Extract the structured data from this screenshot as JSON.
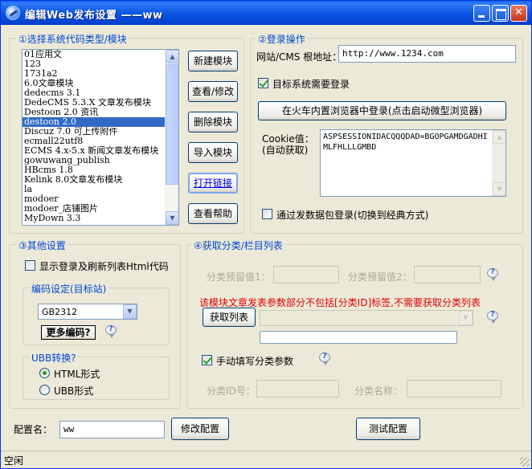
{
  "window": {
    "title": "编辑Web发布设置 ——ww"
  },
  "module": {
    "legend": "①选择系统代码类型/模块",
    "items": [
      "01应用文",
      "123",
      "1731a2",
      "6.0文章模块",
      "dedecms 3.1",
      "DedeCMS 5.3.X 文章发布模块",
      "Destoon 2.0 资讯",
      "destoon 2.0",
      "Discuz 7.0 可上传附件",
      "ecmall22utf8",
      "ECMS 4.x-5.x 新闻文章发布模块",
      "gowuwang_publish",
      "HBcms 1.8",
      "Kelink 8.0文章发布模块",
      "la",
      "modoer",
      "modoer_店铺图片",
      "MyDown 3.3"
    ],
    "selected": "destoon 2.0",
    "buttons": {
      "new": "新建模块",
      "edit": "查看/修改",
      "delete": "删除模块",
      "import": "导入模块",
      "open_link": "打开链接",
      "help": "查看帮助"
    }
  },
  "login": {
    "legend": "②登录操作",
    "url_label": "网站/CMS 根地址：",
    "url_value": "http://www.1234.com",
    "need_login_label": "目标系统需要登录",
    "need_login_checked": true,
    "browser_login_button": "在火车内置浏览器中登录(点击启动微型浏览器)",
    "cookie_label": "Cookie值：",
    "cookie_sub_label": "(自动获取)",
    "cookie_value": "ASPSESSIONIDACQQQDAD=BGOPGAMDGADHIMLFHLLLGMBD",
    "packet_login_label": "通过发数据包登录(切换到经典方式)",
    "packet_login_checked": false
  },
  "other": {
    "legend": "③其他设置",
    "show_html_label": "显示登录及刷新列表Html代码",
    "show_html_checked": false,
    "encoding_legend": "编码设定(目标站)",
    "encoding_value": "GB2312",
    "more_encoding_button": "更多编码?",
    "ubb_legend": "UBB转换?",
    "html_option": "HTML形式",
    "ubb_option": "UBB形式",
    "selected_option": "HTML形式"
  },
  "category": {
    "legend": "④获取分类/栏目列表",
    "reserved1_label": "分类预留值1：",
    "reserved2_label": "分类预留值2：",
    "warning": "该模块文章发表参数部分不包括[分类ID]标签,不需要获取分类列表",
    "get_list_button": "获取列表",
    "manual_label": "手动填写分类参数",
    "manual_checked": true,
    "cat_id_label": "分类ID号：",
    "cat_name_label": "分类名称："
  },
  "footer": {
    "config_name_label": "配置名：",
    "config_name_value": "ww",
    "modify_button": "修改配置",
    "test_button": "测试配置"
  },
  "status": {
    "text": "空闲"
  },
  "colors": {
    "accent": "#0046d5",
    "warning": "#e00000",
    "selection": "#316ac5",
    "titlebar": "#0b56e3"
  }
}
